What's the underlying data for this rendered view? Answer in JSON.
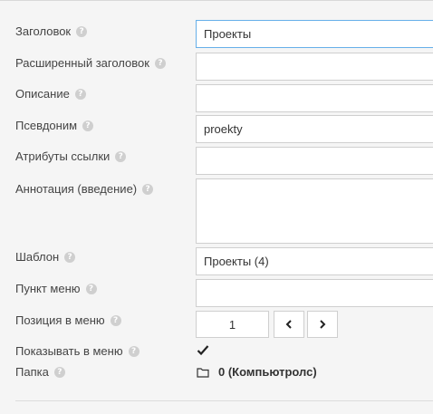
{
  "fields": {
    "title": {
      "label": "Заголовок",
      "value": "Проекты"
    },
    "ext_title": {
      "label": "Расширенный заголовок",
      "value": ""
    },
    "description": {
      "label": "Описание",
      "value": ""
    },
    "alias": {
      "label": "Псевдоним",
      "value": "proekty"
    },
    "link_attrs": {
      "label": "Атрибуты ссылки",
      "value": ""
    },
    "annotation": {
      "label": "Аннотация (введение)",
      "value": ""
    },
    "template": {
      "label": "Шаблон",
      "value": "Проекты (4)"
    },
    "menu_item": {
      "label": "Пункт меню",
      "value": ""
    },
    "menu_position": {
      "label": "Позиция в меню",
      "value": "1"
    },
    "show_in_menu": {
      "label": "Показывать в меню",
      "checked": true
    },
    "folder": {
      "label": "Папка",
      "value": "0 (Компьютролс)"
    }
  },
  "help_glyph": "?",
  "icons": {
    "help": "question-circle-icon",
    "prev": "chevron-left-icon",
    "next": "chevron-right-icon",
    "check": "checkmark-icon",
    "folder": "folder-icon"
  },
  "colors": {
    "background": "#f5f5f5",
    "input_border": "#cfcfcf",
    "focus_border": "#66afe9"
  }
}
